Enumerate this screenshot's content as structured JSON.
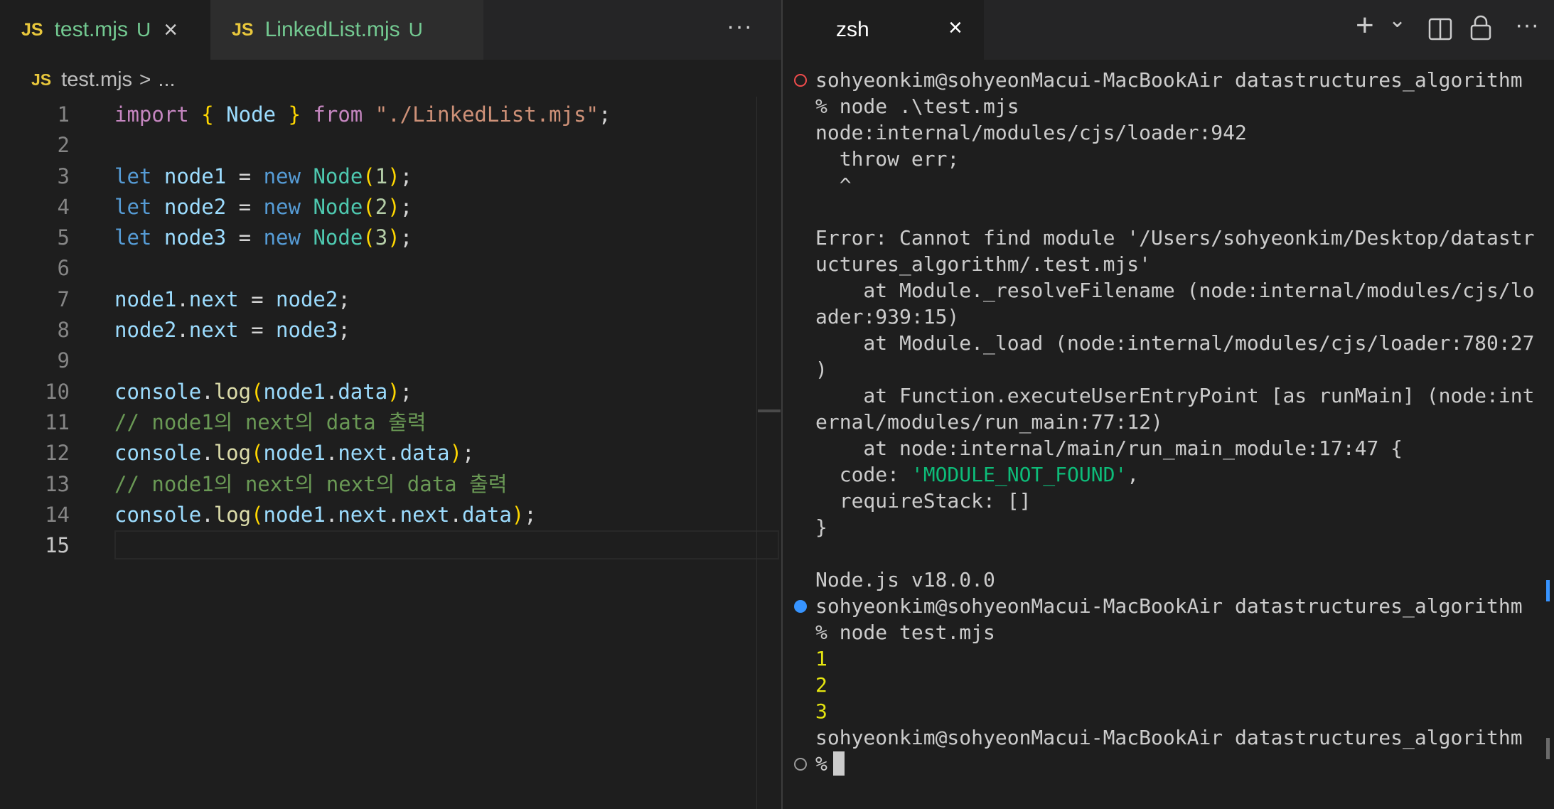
{
  "editor": {
    "tabs": [
      {
        "badge": "JS",
        "name": "test.mjs",
        "status": "U",
        "close": "×"
      },
      {
        "badge": "JS",
        "name": "LinkedList.mjs",
        "status": "U"
      }
    ],
    "more": "···",
    "breadcrumb": {
      "badge": "JS",
      "file": "test.mjs",
      "sep": ">",
      "more": "..."
    },
    "line_numbers": [
      "1",
      "2",
      "3",
      "4",
      "5",
      "6",
      "7",
      "8",
      "9",
      "10",
      "11",
      "12",
      "13",
      "14",
      "15"
    ],
    "current_line": 15,
    "tok": {
      "import": "import",
      "from": "from",
      "let": "let",
      "new": "new",
      "lbrace": "{",
      "rbrace": "}",
      "Node": "Node",
      "path": "\"./LinkedList.mjs\"",
      "semi": ";",
      "eq": "=",
      "lp": "(",
      "rp": ")",
      "dot": ".",
      "node1": "node1",
      "node2": "node2",
      "node3": "node3",
      "n1": "1",
      "n2": "2",
      "n3": "3",
      "next": "next",
      "data": "data",
      "console": "console",
      "log": "log",
      "comment1": "// node1의 next의 data 출력",
      "comment2": "// node1의 next의 next의 data 출력"
    }
  },
  "terminal": {
    "tab_name": "zsh",
    "tab_close": "×",
    "tools": {
      "add": "+",
      "dropdown": "⌄",
      "split": "split-icon",
      "lock": "lock-icon",
      "more": "···"
    },
    "lines": [
      "sohyeonkim@sohyeonMacui-MacBookAir datastructures_algorithm",
      "% node .\\test.mjs",
      "node:internal/modules/cjs/loader:942",
      "  throw err;",
      "  ^",
      "",
      "Error: Cannot find module '/Users/sohyeonkim/Desktop/datastr",
      "uctures_algorithm/.test.mjs'",
      "    at Module._resolveFilename (node:internal/modules/cjs/lo",
      "ader:939:15)",
      "    at Module._load (node:internal/modules/cjs/loader:780:27",
      ")",
      "    at Function.executeUserEntryPoint [as runMain] (node:int",
      "ernal/modules/run_main:77:12)",
      "    at node:internal/main/run_main_module:17:47 {",
      "  code: ",
      "'MODULE_NOT_FOUND'",
      ",",
      "  requireStack: []",
      "}",
      "",
      "Node.js v18.0.0",
      "sohyeonkim@sohyeonMacui-MacBookAir datastructures_algorithm",
      "% node test.mjs",
      "1",
      "2",
      "3",
      "sohyeonkim@sohyeonMacui-MacBookAir datastructures_algorithm",
      "%"
    ],
    "colors": {
      "error_marker": "#f14c4c",
      "success_marker": "#3794ff",
      "string": "#0dbc79",
      "output": "#e5e510"
    }
  }
}
